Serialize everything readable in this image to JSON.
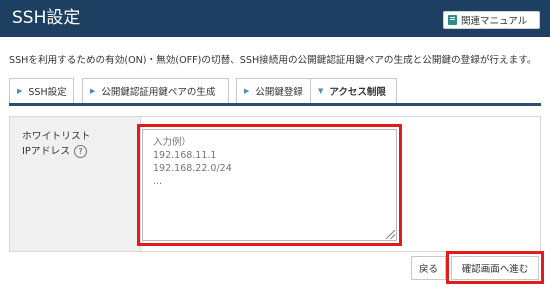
{
  "header": {
    "title": "SSH設定",
    "manual_button": {
      "label": "関連マニュアル",
      "icon": "book-icon"
    }
  },
  "description": "SSHを利用するための有効(ON)・無効(OFF)の切替、SSH接続用の公開鍵認証用鍵ペアの生成と公開鍵の登録が行えます。",
  "tabs": [
    {
      "label": "SSH設定",
      "icon": "triangle-right-icon",
      "active": false
    },
    {
      "label": "公開鍵認証用鍵ペアの生成",
      "icon": "triangle-right-icon",
      "active": false
    },
    {
      "label": "公開鍵登録",
      "icon": "triangle-right-icon",
      "active": false
    },
    {
      "label": "アクセス制限",
      "icon": "triangle-down-icon",
      "active": true
    }
  ],
  "form": {
    "label_line1": "ホワイトリスト",
    "label_line2": "IPアドレス",
    "help_icon": "question-circle-icon",
    "whitelist_placeholder": "入力例）\n192.168.11.1\n192.168.22.0/24\n...",
    "whitelist_value": ""
  },
  "actions": {
    "back_label": "戻る",
    "next_label": "確認画面へ進む"
  },
  "colors": {
    "header_bg": "#1d3f62",
    "tab_accent": "#2a4f74",
    "highlight": "#e21b1b",
    "label_bg": "#f0f0f0"
  }
}
